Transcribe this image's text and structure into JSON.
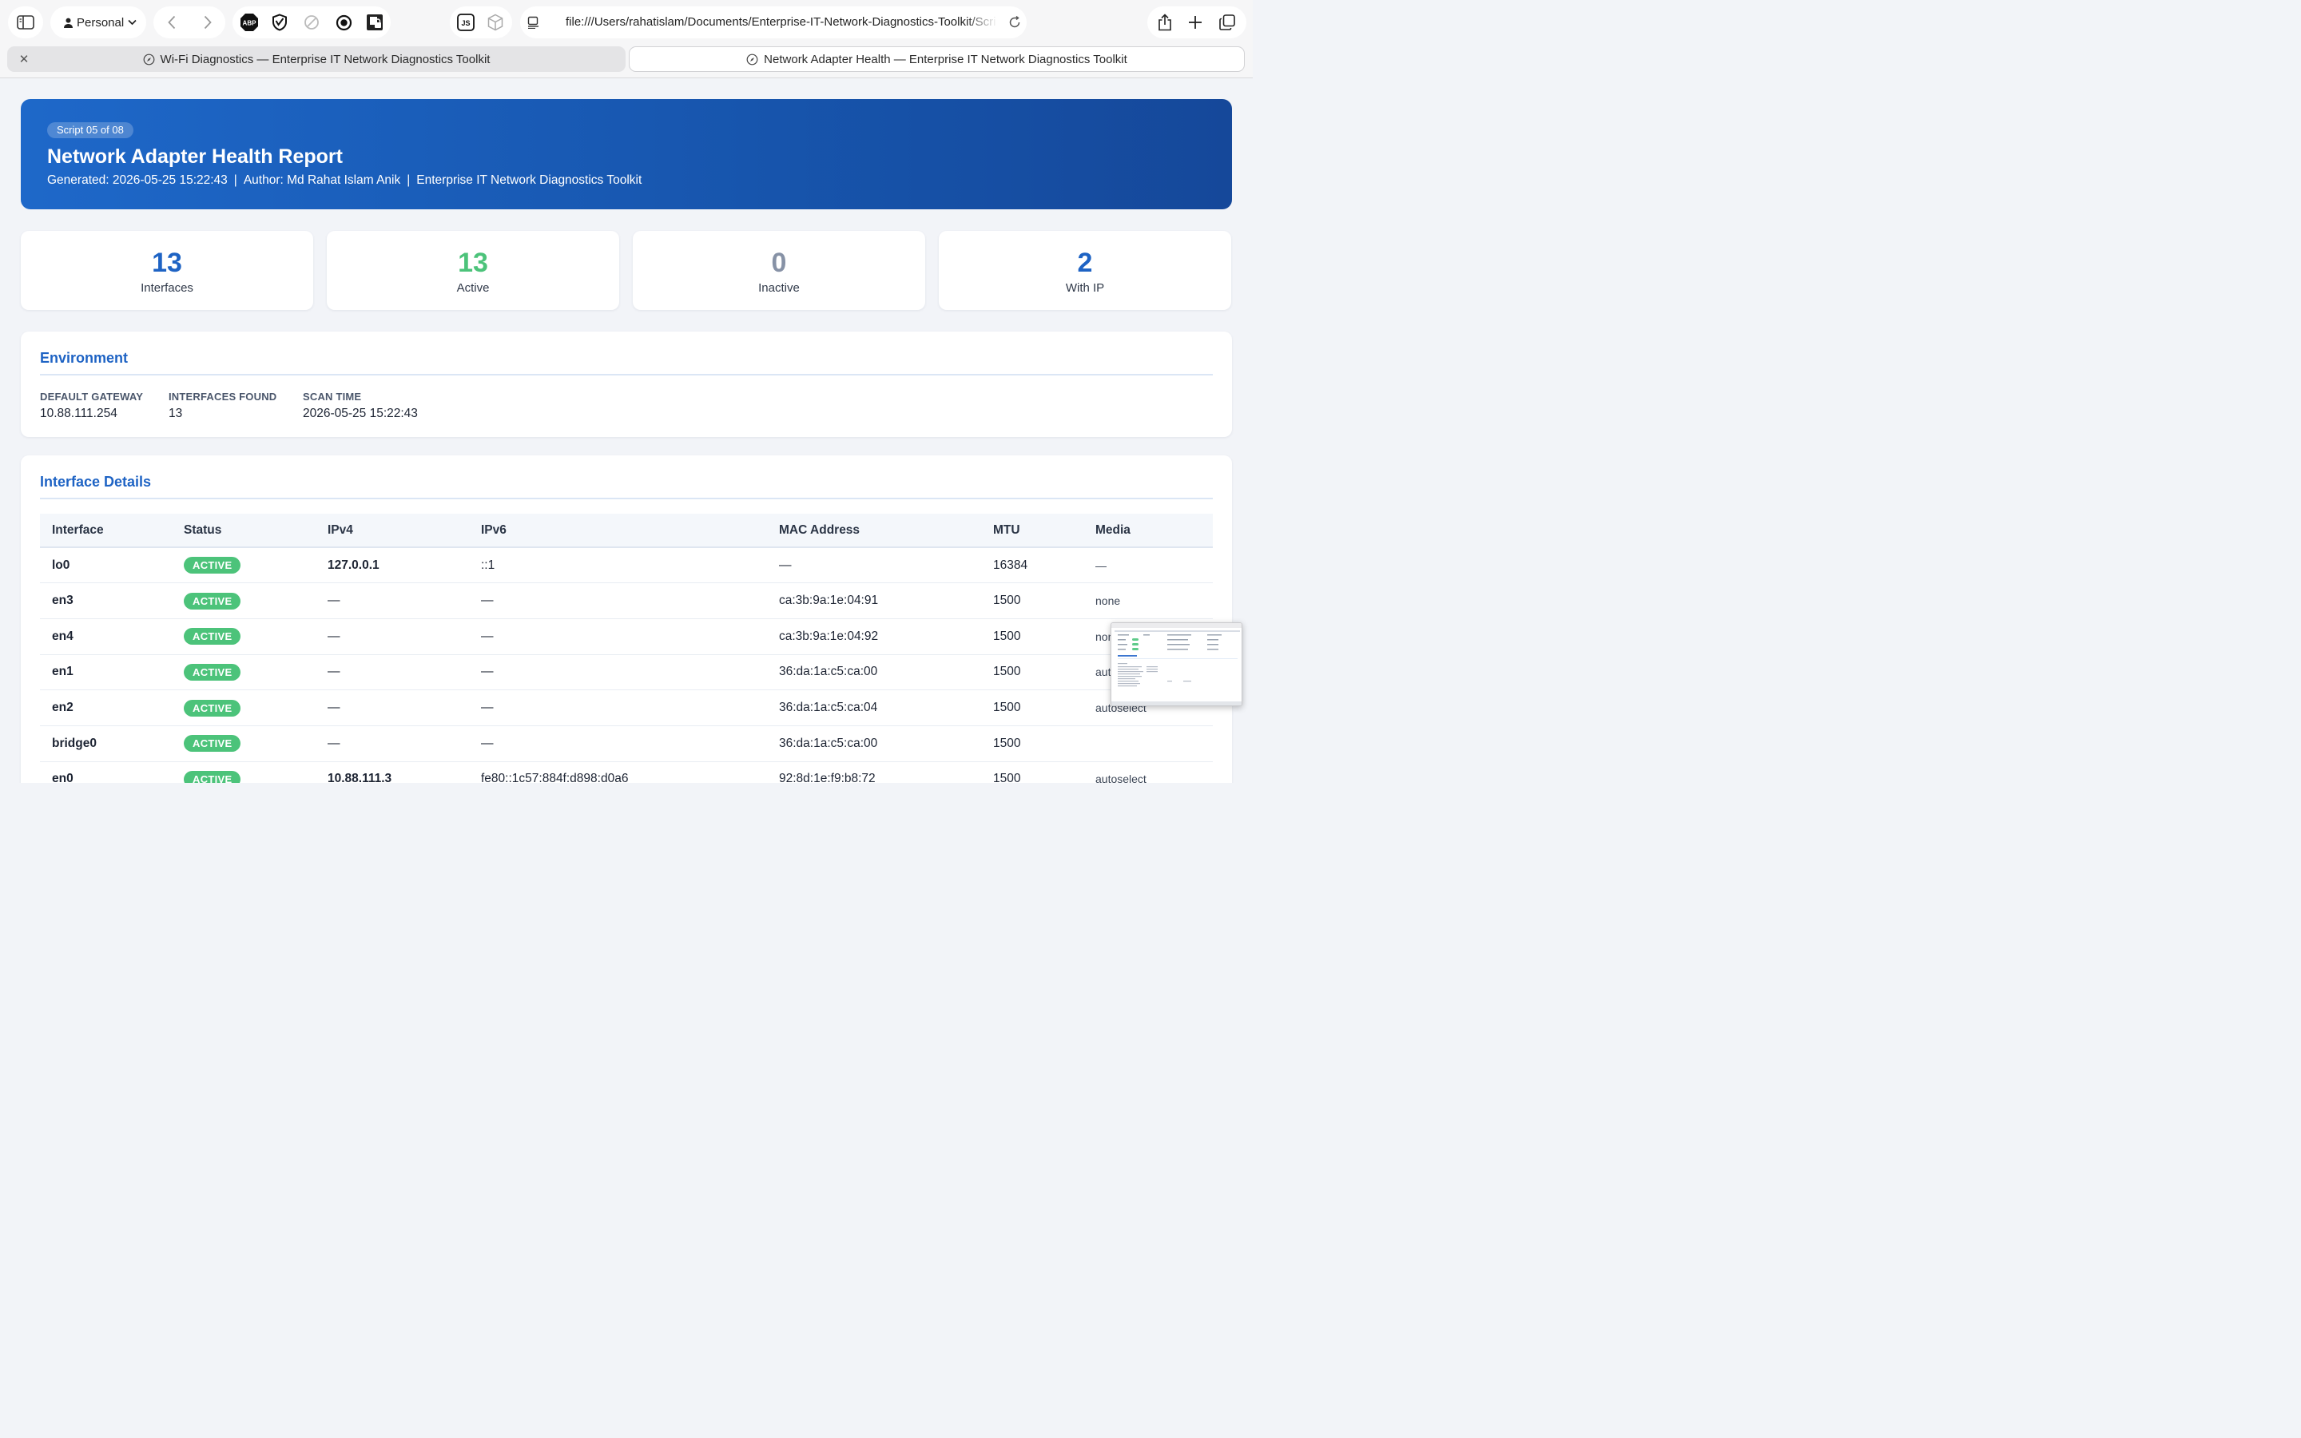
{
  "browser": {
    "profile_label": "Personal",
    "url": "file:///Users/rahatislam/Documents/Enterprise-IT-Network-Diagnostics-Toolkit/Scri",
    "tabs": [
      {
        "title": "Wi-Fi Diagnostics — Enterprise IT Network Diagnostics Toolkit",
        "active": false
      },
      {
        "title": "Network Adapter Health — Enterprise IT Network Diagnostics Toolkit",
        "active": true
      }
    ],
    "extension_icons": [
      "adblock-icon",
      "shield-v-icon",
      "disabled-icon",
      "record-icon",
      "lock-icon"
    ],
    "toolbar_icons": [
      "sidebar-icon",
      "back-icon",
      "forward-icon",
      "js-icon",
      "cube-icon",
      "reader-icon",
      "reload-icon",
      "share-icon",
      "new-tab-icon",
      "tabs-overview-icon"
    ]
  },
  "header": {
    "badge": "Script 05 of 08",
    "title": "Network Adapter Health Report",
    "generated": "Generated: 2026-05-25 15:22:43",
    "author": "Author: Md Rahat Islam Anik",
    "toolkit": "Enterprise IT Network Diagnostics Toolkit",
    "separator": "|"
  },
  "stats": [
    {
      "value": "13",
      "label": "Interfaces",
      "color": "#1e63c4"
    },
    {
      "value": "13",
      "label": "Active",
      "color": "#4cc37a"
    },
    {
      "value": "0",
      "label": "Inactive",
      "color": "#8792a6"
    },
    {
      "value": "2",
      "label": "With IP",
      "color": "#1e63c4"
    }
  ],
  "environment": {
    "title": "Environment",
    "items": [
      {
        "key": "DEFAULT GATEWAY",
        "value": "10.88.111.254"
      },
      {
        "key": "INTERFACES FOUND",
        "value": "13"
      },
      {
        "key": "SCAN TIME",
        "value": "2026-05-25 15:22:43"
      }
    ]
  },
  "interfaces": {
    "title": "Interface Details",
    "columns": [
      "Interface",
      "Status",
      "IPv4",
      "IPv6",
      "MAC Address",
      "MTU",
      "Media"
    ],
    "rows": [
      {
        "iface": "lo0",
        "status": "ACTIVE",
        "ipv4": "127.0.0.1",
        "ipv6": "::1",
        "mac": "—",
        "mtu": "16384",
        "media": "—"
      },
      {
        "iface": "en3",
        "status": "ACTIVE",
        "ipv4": "—",
        "ipv6": "—",
        "mac": "ca:3b:9a:1e:04:91",
        "mtu": "1500",
        "media": "none"
      },
      {
        "iface": "en4",
        "status": "ACTIVE",
        "ipv4": "—",
        "ipv6": "—",
        "mac": "ca:3b:9a:1e:04:92",
        "mtu": "1500",
        "media": "none"
      },
      {
        "iface": "en1",
        "status": "ACTIVE",
        "ipv4": "—",
        "ipv6": "—",
        "mac": "36:da:1a:c5:ca:00",
        "mtu": "1500",
        "media": "autoselect"
      },
      {
        "iface": "en2",
        "status": "ACTIVE",
        "ipv4": "—",
        "ipv6": "—",
        "mac": "36:da:1a:c5:ca:04",
        "mtu": "1500",
        "media": "autoselect"
      },
      {
        "iface": "bridge0",
        "status": "ACTIVE",
        "ipv4": "—",
        "ipv6": "—",
        "mac": "36:da:1a:c5:ca:00",
        "mtu": "1500",
        "media": ""
      },
      {
        "iface": "en0",
        "status": "ACTIVE",
        "ipv4": "10.88.111.3",
        "ipv6": "fe80::1c57:884f:d898:d0a6",
        "mac": "92:8d:1e:f9:b8:72",
        "mtu": "1500",
        "media": "autoselect"
      }
    ]
  }
}
